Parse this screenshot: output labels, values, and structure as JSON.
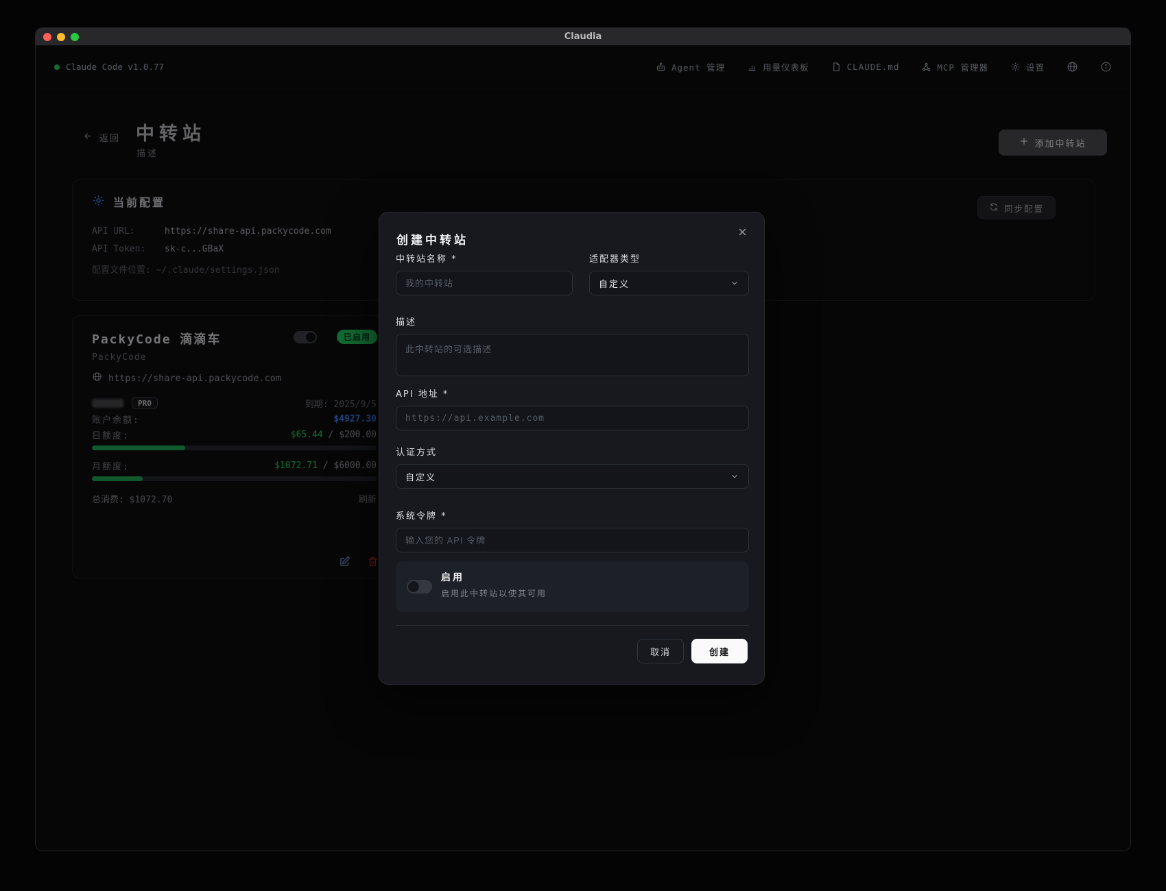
{
  "window": {
    "title": "Claudia"
  },
  "nav": {
    "brand": "Claude Code v1.0.77",
    "items": [
      {
        "label": "Agent 管理",
        "icon": "bot-icon"
      },
      {
        "label": "用量仪表板",
        "icon": "bar-chart-icon"
      },
      {
        "label": "CLAUDE.md",
        "icon": "file-icon"
      },
      {
        "label": "MCP 管理器",
        "icon": "network-icon"
      },
      {
        "label": "设置",
        "icon": "gear-icon"
      }
    ],
    "trailing_icons": [
      "globe-icon",
      "info-icon"
    ]
  },
  "header": {
    "back_label": "返回",
    "title": "中转站",
    "subtitle": "描述",
    "add_button": "添加中转站"
  },
  "config_card": {
    "title": "当前配置",
    "sync_button": "同步配置",
    "api_url_label": "API URL:",
    "api_url": "https://share-api.packycode.com",
    "api_token_label": "API Token:",
    "api_token": "sk-c...GBaX",
    "config_path": "配置文件位置: ~/.claude/settings.json"
  },
  "station_card": {
    "name": "PackyCode 滴滴车",
    "enabled_badge": "已启用",
    "provider": "PackyCode",
    "url": "https://share-api.packycode.com",
    "plan_badge": "PRO",
    "expiry": "到期: 2025/9/5",
    "balance_label": "账户余额:",
    "balance_value": "$4927.30",
    "daily_label": "日额度:",
    "daily_used": "$65.44",
    "daily_total": " / $200.00",
    "daily_percent": 32.7,
    "monthly_label": "月额度:",
    "monthly_used": "$1072.71",
    "monthly_total": " / $6000.00",
    "monthly_percent": 17.9,
    "total_spent": "总消费: $1072.70",
    "refresh_label": "刷新"
  },
  "modal": {
    "title": "创建中转站",
    "name_label": "中转站名称 *",
    "name_placeholder": "我的中转站",
    "adapter_label": "适配器类型",
    "adapter_value": "自定义",
    "desc_label": "描述",
    "desc_placeholder": "此中转站的可选描述",
    "api_label": "API 地址 *",
    "api_placeholder": "https://api.example.com",
    "auth_label": "认证方式",
    "auth_value": "自定义",
    "token_label": "系统令牌 *",
    "token_placeholder": "输入您的 API 令牌",
    "enable_title": "启用",
    "enable_desc": "启用此中转站以使其可用",
    "cancel_button": "取消",
    "create_button": "创建"
  },
  "colors": {
    "accent_blue": "#3b82f6",
    "success_green": "#22c55e",
    "danger_red": "#dc2626",
    "modal_bg": "#17191f",
    "window_bg": "#0b0b0c"
  }
}
